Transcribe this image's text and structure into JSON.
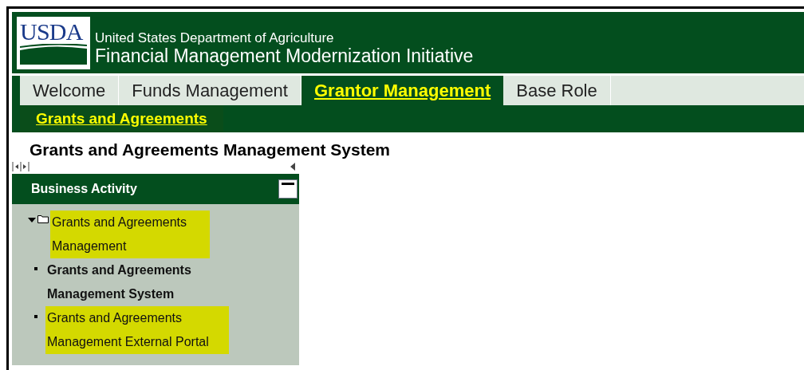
{
  "header": {
    "logo": "USDA",
    "department": "United States Department of Agriculture",
    "title": "Financial Management Modernization Initiative"
  },
  "tabs": [
    {
      "label": "Welcome",
      "selected": false
    },
    {
      "label": "Funds Management",
      "selected": false
    },
    {
      "label": "Grantor Management",
      "selected": true
    },
    {
      "label": "Base Role",
      "selected": false
    }
  ],
  "subnav": [
    {
      "label": "Grants and Agreements",
      "selected": true
    }
  ],
  "page_title": "Grants and Agreements Management System",
  "sidebar": {
    "title": "Business Activity",
    "tree": [
      {
        "label": "Grants and Agreements Management",
        "expanded": true,
        "highlighted": true,
        "selected": false,
        "children": [
          {
            "label": "Grants and Agreements Management System",
            "highlighted": false,
            "selected": true
          },
          {
            "label": "Grants and Agreements Management External Portal",
            "highlighted": true,
            "selected": false
          }
        ]
      }
    ]
  }
}
